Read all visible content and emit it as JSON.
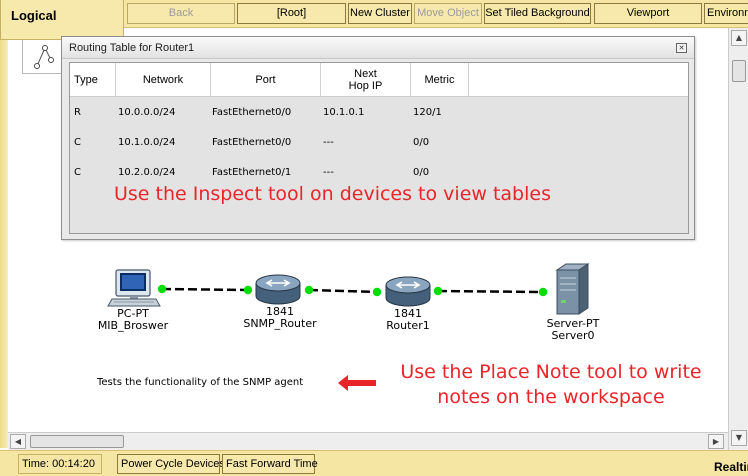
{
  "toolbar": {
    "logical_tab": "Logical",
    "buttons": [
      "Back",
      "[Root]",
      "New Cluster",
      "Move Object",
      "Set Tiled Background",
      "Viewport",
      "Environment"
    ]
  },
  "routing_window": {
    "title": "Routing Table for Router1",
    "columns": [
      "Type",
      "Network",
      "Port",
      "Next\nHop IP",
      "Metric"
    ],
    "rows": [
      [
        "R",
        "10.0.0.0/24",
        "FastEthernet0/0",
        "10.1.0.1",
        "120/1"
      ],
      [
        "C",
        "10.1.0.0/24",
        "FastEthernet0/0",
        "---",
        "0/0"
      ],
      [
        "C",
        "10.2.0.0/24",
        "FastEthernet0/1",
        "---",
        "0/0"
      ]
    ],
    "hint": "Use the Inspect tool on devices to view tables"
  },
  "topology": {
    "devices": [
      {
        "model": "PC-PT",
        "name": "MIB_Broswer",
        "icon": "pc-icon"
      },
      {
        "model": "1841",
        "name": "SNMP_Router",
        "icon": "router-icon"
      },
      {
        "model": "1841",
        "name": "Router1",
        "icon": "router-icon"
      },
      {
        "model": "Server-PT",
        "name": "Server0",
        "icon": "server-icon"
      }
    ],
    "link_color": "#000000",
    "port_status_color": "#00dd00"
  },
  "note": {
    "text": "Tests the functionality of the SNMP agent",
    "hint": "Use the Place Note tool to write notes on the workspace",
    "hint_color": "#e8262a"
  },
  "bottom": {
    "time_label": "Time: 00:14:20",
    "power_cycle": "Power Cycle Devices",
    "fast_forward": "Fast Forward Time",
    "realtime": "Realtime"
  }
}
